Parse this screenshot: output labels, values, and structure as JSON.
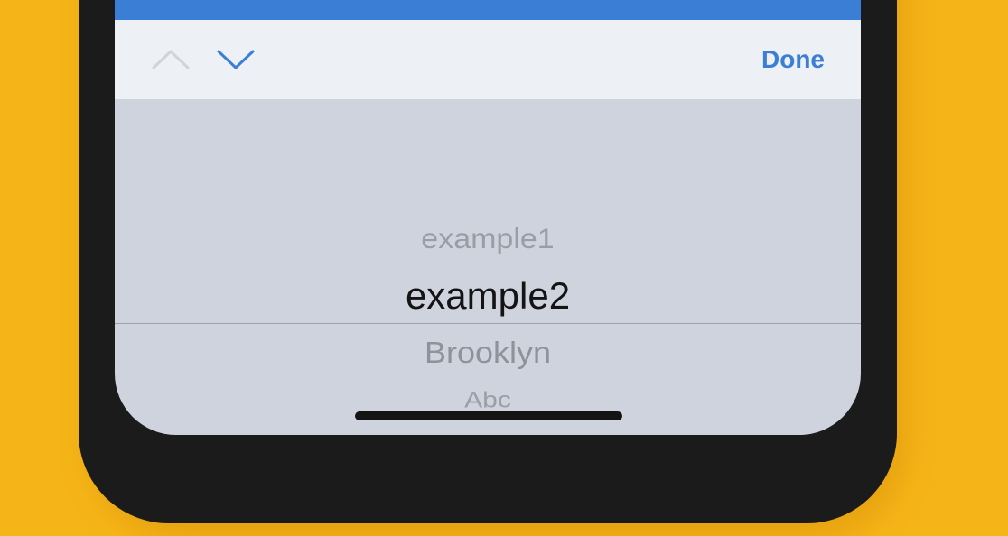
{
  "toolbar": {
    "prev_icon": "chevron-up-icon",
    "next_icon": "chevron-down-icon",
    "done_label": "Done"
  },
  "picker": {
    "options": [
      "example1",
      "example2",
      "Brooklyn",
      "Abc"
    ],
    "selected": "example2"
  },
  "colors": {
    "background": "#F5B417",
    "accent": "#3A7FD5",
    "frame": "#1B1B1B",
    "accessory_bar": "#EDF0F5",
    "picker_bg": "#CED3DD"
  }
}
